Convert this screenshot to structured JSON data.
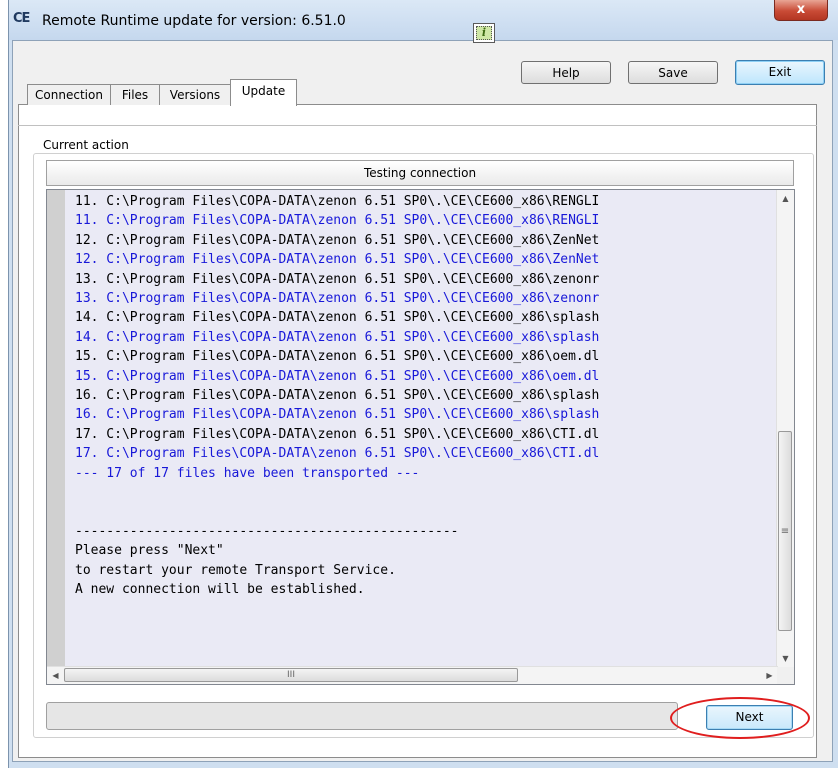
{
  "window": {
    "title": "Remote Runtime update for version: 6.51.0",
    "app_icon_text": "CE",
    "close_label": "x"
  },
  "toolbar": {
    "info_label": "i",
    "help_label": "Help",
    "save_label": "Save",
    "exit_label": "Exit"
  },
  "tabs": [
    {
      "label": "Connection",
      "active": false
    },
    {
      "label": "Files",
      "active": false
    },
    {
      "label": "Versions",
      "active": false
    },
    {
      "label": "Update",
      "active": true
    }
  ],
  "current_action": {
    "group_label": "Current action",
    "status": "Testing connection"
  },
  "log": {
    "lines": [
      {
        "text": "11. C:\\Program Files\\COPA-DATA\\zenon 6.51 SP0\\.\\CE\\CE600_x86\\RENGLI",
        "color": "black"
      },
      {
        "text": "11. C:\\Program Files\\COPA-DATA\\zenon 6.51 SP0\\.\\CE\\CE600_x86\\RENGLI",
        "color": "blue"
      },
      {
        "text": "12. C:\\Program Files\\COPA-DATA\\zenon 6.51 SP0\\.\\CE\\CE600_x86\\ZenNet",
        "color": "black"
      },
      {
        "text": "12. C:\\Program Files\\COPA-DATA\\zenon 6.51 SP0\\.\\CE\\CE600_x86\\ZenNet",
        "color": "blue"
      },
      {
        "text": "13. C:\\Program Files\\COPA-DATA\\zenon 6.51 SP0\\.\\CE\\CE600_x86\\zenonr",
        "color": "black"
      },
      {
        "text": "13. C:\\Program Files\\COPA-DATA\\zenon 6.51 SP0\\.\\CE\\CE600_x86\\zenonr",
        "color": "blue"
      },
      {
        "text": "14. C:\\Program Files\\COPA-DATA\\zenon 6.51 SP0\\.\\CE\\CE600_x86\\splash",
        "color": "black"
      },
      {
        "text": "14. C:\\Program Files\\COPA-DATA\\zenon 6.51 SP0\\.\\CE\\CE600_x86\\splash",
        "color": "blue"
      },
      {
        "text": "15. C:\\Program Files\\COPA-DATA\\zenon 6.51 SP0\\.\\CE\\CE600_x86\\oem.dl",
        "color": "black"
      },
      {
        "text": "15. C:\\Program Files\\COPA-DATA\\zenon 6.51 SP0\\.\\CE\\CE600_x86\\oem.dl",
        "color": "blue"
      },
      {
        "text": "16. C:\\Program Files\\COPA-DATA\\zenon 6.51 SP0\\.\\CE\\CE600_x86\\splash",
        "color": "black"
      },
      {
        "text": "16. C:\\Program Files\\COPA-DATA\\zenon 6.51 SP0\\.\\CE\\CE600_x86\\splash",
        "color": "blue"
      },
      {
        "text": "17. C:\\Program Files\\COPA-DATA\\zenon 6.51 SP0\\.\\CE\\CE600_x86\\CTI.dl",
        "color": "black"
      },
      {
        "text": "17. C:\\Program Files\\COPA-DATA\\zenon 6.51 SP0\\.\\CE\\CE600_x86\\CTI.dl",
        "color": "blue"
      },
      {
        "text": "--- 17 of 17 files have been transported ---",
        "color": "blue"
      },
      {
        "text": "",
        "color": "black"
      },
      {
        "text": "",
        "color": "black"
      },
      {
        "text": "-------------------------------------------------",
        "color": "black"
      },
      {
        "text": "Please press \"Next\"",
        "color": "black"
      },
      {
        "text": "to restart your remote Transport Service.",
        "color": "black"
      },
      {
        "text": "A new connection will be established.",
        "color": "black"
      }
    ]
  },
  "scrollbars": {
    "vertical_grip": "≡",
    "horizontal_grip": "III"
  },
  "progress": {
    "fraction": 0
  },
  "actions": {
    "next_label": "Next"
  },
  "colors": {
    "log_blue": "#1818d8",
    "log_black": "#000000",
    "highlight": "#e01e1e"
  }
}
